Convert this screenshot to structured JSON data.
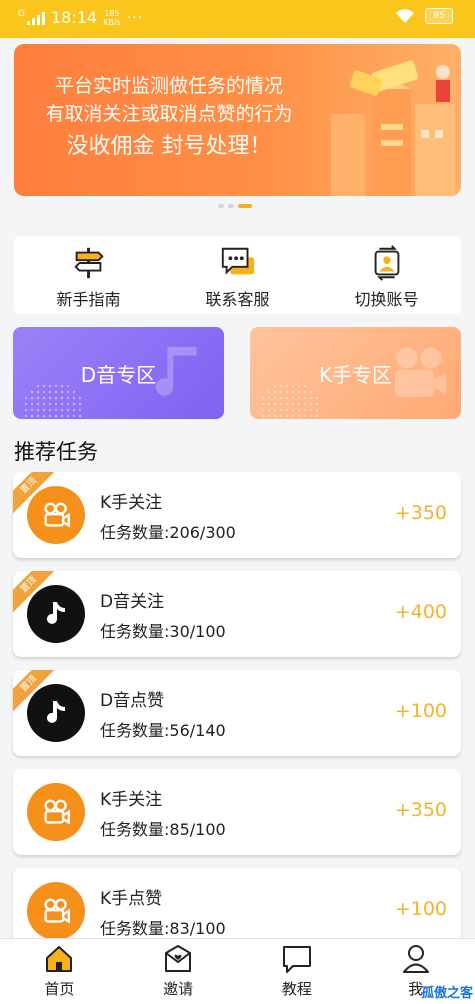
{
  "status_bar": {
    "network": "G",
    "time": "18:14",
    "speed_value": "185",
    "speed_unit": "KB/s",
    "more": "···",
    "battery": "95"
  },
  "banner": {
    "line1": "平台实时监测做任务的情况",
    "line2": "有取消关注或取消点赞的行为",
    "line3": "没收佣金  封号处理！",
    "slide_count": 3,
    "active_slide": 3
  },
  "quick_actions": [
    {
      "label": "新手指南",
      "icon": "signpost-icon"
    },
    {
      "label": "联系客服",
      "icon": "chat-icon"
    },
    {
      "label": "切换账号",
      "icon": "switch-account-icon"
    }
  ],
  "zones": [
    {
      "label": "D音专区",
      "color": "#8b71f5"
    },
    {
      "label": "K手专区",
      "color": "#ffb283"
    }
  ],
  "section_title": "推荐任务",
  "tasks": [
    {
      "name": "K手关注",
      "count": "任务数量:206/300",
      "reward": "+350",
      "pinned": true,
      "pin_label": "置顶",
      "type": "k"
    },
    {
      "name": "D音关注",
      "count": "任务数量:30/100",
      "reward": "+400",
      "pinned": true,
      "pin_label": "置顶",
      "type": "d"
    },
    {
      "name": "D音点赞",
      "count": "任务数量:56/140",
      "reward": "+100",
      "pinned": true,
      "pin_label": "置顶",
      "type": "d"
    },
    {
      "name": "K手关注",
      "count": "任务数量:85/100",
      "reward": "+350",
      "pinned": false,
      "type": "k"
    },
    {
      "name": "K手点赞",
      "count": "任务数量:83/100",
      "reward": "+100",
      "pinned": false,
      "type": "k"
    }
  ],
  "tabbar": [
    {
      "label": "首页",
      "icon": "home-icon",
      "active": true
    },
    {
      "label": "邀请",
      "icon": "invite-icon",
      "active": false
    },
    {
      "label": "教程",
      "icon": "tutorial-icon",
      "active": false
    },
    {
      "label": "我",
      "icon": "profile-icon",
      "active": false
    }
  ],
  "watermark": "孤傲之客",
  "colors": {
    "accent": "#fbc61c",
    "reward": "#f5b32a",
    "kuaishou": "#f5901a"
  }
}
